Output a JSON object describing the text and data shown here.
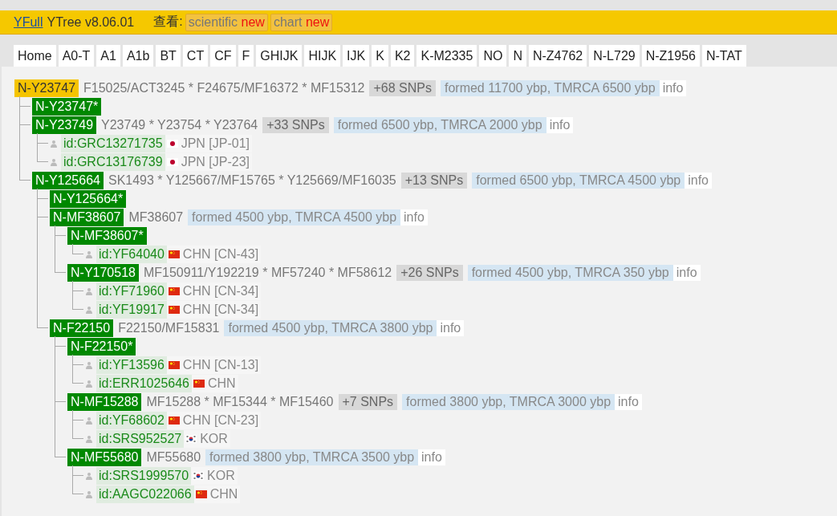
{
  "header": {
    "brand_link": "YFull",
    "version": "YTree v8.06.01",
    "view_label": "查看:",
    "view_buttons": [
      {
        "label": "scientific",
        "badge": "new"
      },
      {
        "label": "chart",
        "badge": "new"
      }
    ]
  },
  "tabs": [
    {
      "label": "Home"
    },
    {
      "label": "A0-T"
    },
    {
      "label": "A1"
    },
    {
      "label": "A1b"
    },
    {
      "label": "BT"
    },
    {
      "label": "CT"
    },
    {
      "label": "CF"
    },
    {
      "label": "F"
    },
    {
      "label": "GHIJK"
    },
    {
      "label": "HIJK"
    },
    {
      "label": "IJK"
    },
    {
      "label": "K"
    },
    {
      "label": "K2"
    },
    {
      "label": "K-M2335"
    },
    {
      "label": "NO"
    },
    {
      "label": "N"
    },
    {
      "label": "N-Z4762"
    },
    {
      "label": "N-L729"
    },
    {
      "label": "N-Z1956"
    },
    {
      "label": "N-TAT"
    }
  ],
  "tree": {
    "kind": "current",
    "name": "N-Y23747",
    "snps": "F15025/ACT3245 * F24675/MF16372 * MF15312",
    "extra_snps": "+68 SNPs",
    "age": "formed 11700 ybp, TMRCA 6500 ybp",
    "info": "info",
    "children": [
      {
        "kind": "clade",
        "name": "N-Y23747*"
      },
      {
        "kind": "clade",
        "name": "N-Y23749",
        "snps": "Y23749 * Y23754 * Y23764",
        "extra_snps": "+33 SNPs",
        "age": "formed 6500 ybp, TMRCA 2000 ybp",
        "info": "info",
        "children": [
          {
            "kind": "sample",
            "id": "id:GRC13271735",
            "flag": {
              "kind": "JP"
            },
            "country": "JPN [JP-01]"
          },
          {
            "kind": "sample",
            "id": "id:GRC13176739",
            "flag": {
              "kind": "JP"
            },
            "country": "JPN [JP-23]"
          }
        ]
      },
      {
        "kind": "clade",
        "name": "N-Y125664",
        "snps": "SK1493 * Y125667/MF15765 * Y125669/MF16035",
        "extra_snps": "+13 SNPs",
        "age": "formed 6500 ybp, TMRCA 4500 ybp",
        "info": "info",
        "children": [
          {
            "kind": "clade",
            "name": "N-Y125664*"
          },
          {
            "kind": "clade",
            "name": "N-MF38607",
            "snps": "MF38607",
            "age": "formed 4500 ybp, TMRCA 4500 ybp",
            "info": "info",
            "children": [
              {
                "kind": "clade",
                "name": "N-MF38607*",
                "children": [
                  {
                    "kind": "sample",
                    "id": "id:YF64040",
                    "flag": {
                      "kind": "CN"
                    },
                    "country": "CHN [CN-43]"
                  }
                ]
              },
              {
                "kind": "clade",
                "name": "N-Y170518",
                "snps": "MF150911/Y192219 * MF57240 * MF58612",
                "extra_snps": "+26 SNPs",
                "age": "formed 4500 ybp, TMRCA 350 ybp",
                "info": "info",
                "children": [
                  {
                    "kind": "sample",
                    "id": "id:YF71960",
                    "flag": {
                      "kind": "CN"
                    },
                    "country": "CHN [CN-34]"
                  },
                  {
                    "kind": "sample",
                    "id": "id:YF19917",
                    "flag": {
                      "kind": "CN"
                    },
                    "country": "CHN [CN-34]"
                  }
                ]
              }
            ]
          },
          {
            "kind": "clade",
            "name": "N-F22150",
            "snps": "F22150/MF15831",
            "age": "formed 4500 ybp, TMRCA 3800 ybp",
            "info": "info",
            "children": [
              {
                "kind": "clade",
                "name": "N-F22150*",
                "children": [
                  {
                    "kind": "sample",
                    "id": "id:YF13596",
                    "flag": {
                      "kind": "CN"
                    },
                    "country": "CHN [CN-13]"
                  },
                  {
                    "kind": "sample",
                    "id": "id:ERR1025646",
                    "flag": {
                      "kind": "CN"
                    },
                    "country": "CHN"
                  }
                ]
              },
              {
                "kind": "clade",
                "name": "N-MF15288",
                "snps": "MF15288 * MF15344 * MF15460",
                "extra_snps": "+7 SNPs",
                "age": "formed 3800 ybp, TMRCA 3000 ybp",
                "info": "info",
                "children": [
                  {
                    "kind": "sample",
                    "id": "id:YF68602",
                    "flag": {
                      "kind": "CN"
                    },
                    "country": "CHN [CN-23]"
                  },
                  {
                    "kind": "sample",
                    "id": "id:SRS952527",
                    "flag": {
                      "kind": "KR"
                    },
                    "country": "KOR"
                  }
                ]
              },
              {
                "kind": "clade",
                "name": "N-MF55680",
                "snps": "MF55680",
                "age": "formed 3800 ybp, TMRCA 3500 ybp",
                "info": "info",
                "children": [
                  {
                    "kind": "sample",
                    "id": "id:SRS1999570",
                    "flag": {
                      "kind": "KR"
                    },
                    "country": "KOR"
                  },
                  {
                    "kind": "sample",
                    "id": "id:AAGC022066",
                    "flag": {
                      "kind": "CN"
                    },
                    "country": "CHN"
                  }
                ]
              }
            ]
          }
        ]
      }
    ]
  }
}
